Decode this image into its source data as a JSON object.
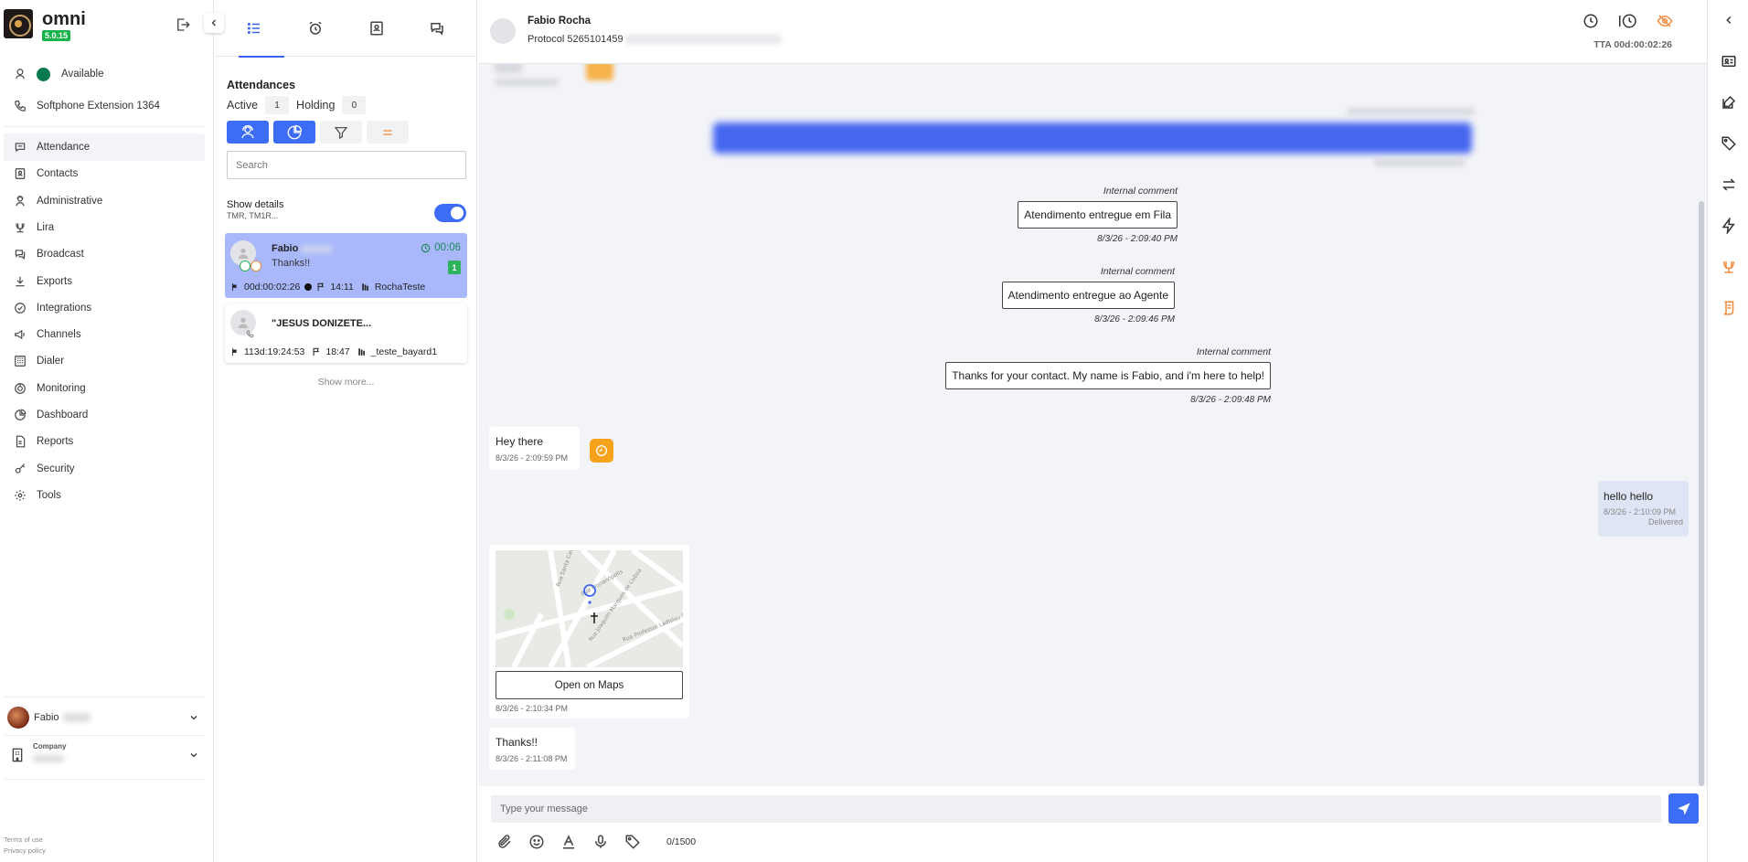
{
  "app": {
    "name": "omni",
    "version": "5.0.15"
  },
  "status": {
    "label": "Available",
    "color": "#087a4f"
  },
  "softphone": {
    "label": "Softphone Extension 1364"
  },
  "nav": [
    {
      "label": "Attendance",
      "icon": "chat-icon",
      "active": true
    },
    {
      "label": "Contacts",
      "icon": "contacts-icon"
    },
    {
      "label": "Administrative",
      "icon": "admin-icon"
    },
    {
      "label": "Lira",
      "icon": "lira-icon"
    },
    {
      "label": "Broadcast",
      "icon": "broadcast-icon"
    },
    {
      "label": "Exports",
      "icon": "download-icon"
    },
    {
      "label": "Integrations",
      "icon": "integrations-icon"
    },
    {
      "label": "Channels",
      "icon": "megaphone-icon"
    },
    {
      "label": "Dialer",
      "icon": "dialer-icon"
    },
    {
      "label": "Monitoring",
      "icon": "monitoring-icon"
    },
    {
      "label": "Dashboard",
      "icon": "pie-chart-icon"
    },
    {
      "label": "Reports",
      "icon": "report-icon"
    },
    {
      "label": "Security",
      "icon": "key-icon"
    },
    {
      "label": "Tools",
      "icon": "gear-icon"
    }
  ],
  "user": {
    "first_name": "Fabio"
  },
  "company": {
    "label": "Company"
  },
  "footer": {
    "terms": "Terms of use",
    "privacy": "Privacy policy"
  },
  "list": {
    "title": "Attendances",
    "active_label": "Active",
    "active_count": "1",
    "holding_label": "Holding",
    "holding_count": "0",
    "search_placeholder": "Search",
    "show_details_label": "Show details",
    "show_details_sub": "TMR, TM1R...",
    "show_more": "Show more...",
    "cards": [
      {
        "name": "Fabio",
        "message": "Thanks!!",
        "time": "00:06",
        "unread": "1",
        "duration": "00d:00:02:26",
        "start": "14:11",
        "queue": "RochaTeste"
      },
      {
        "name": "\"JESUS DONIZETE...",
        "duration": "113d:19:24:53",
        "start": "18:47",
        "queue": "_teste_bayard1"
      }
    ]
  },
  "chat": {
    "contact_name": "Fabio Rocha",
    "protocol": "Protocol 5265101459",
    "tta": "TTA 00d:00:02:26",
    "comments": [
      {
        "label": "Internal comment",
        "text": "Atendimento entregue em Fila",
        "time": "8/3/26 - 2:09:40 PM"
      },
      {
        "label": "Internal comment",
        "text": "Atendimento entregue ao Agente",
        "time": "8/3/26 - 2:09:46 PM"
      },
      {
        "label": "Internal comment",
        "text": "Thanks for your contact. My name is Fabio, and i'm here to help!",
        "time": "8/3/26 - 2:09:48 PM"
      }
    ],
    "incoming_1": {
      "text": "Hey there",
      "time": "8/3/26 - 2:09:59 PM"
    },
    "outgoing_1": {
      "text": "hello hello",
      "time": "8/3/26 - 2:10:09 PM",
      "status": "Delivered"
    },
    "location": {
      "button": "Open on Maps",
      "time": "8/3/26 - 2:10:34 PM"
    },
    "incoming_2": {
      "text": "Thanks!!",
      "time": "8/3/26 - 2:11:08 PM"
    },
    "input_placeholder": "Type your message",
    "char_count": "0/1500"
  },
  "colors": {
    "accent": "#3d6cf5",
    "selected_card": "#a8b8fb",
    "bot": "#f6a21b",
    "green": "#2db35b"
  }
}
